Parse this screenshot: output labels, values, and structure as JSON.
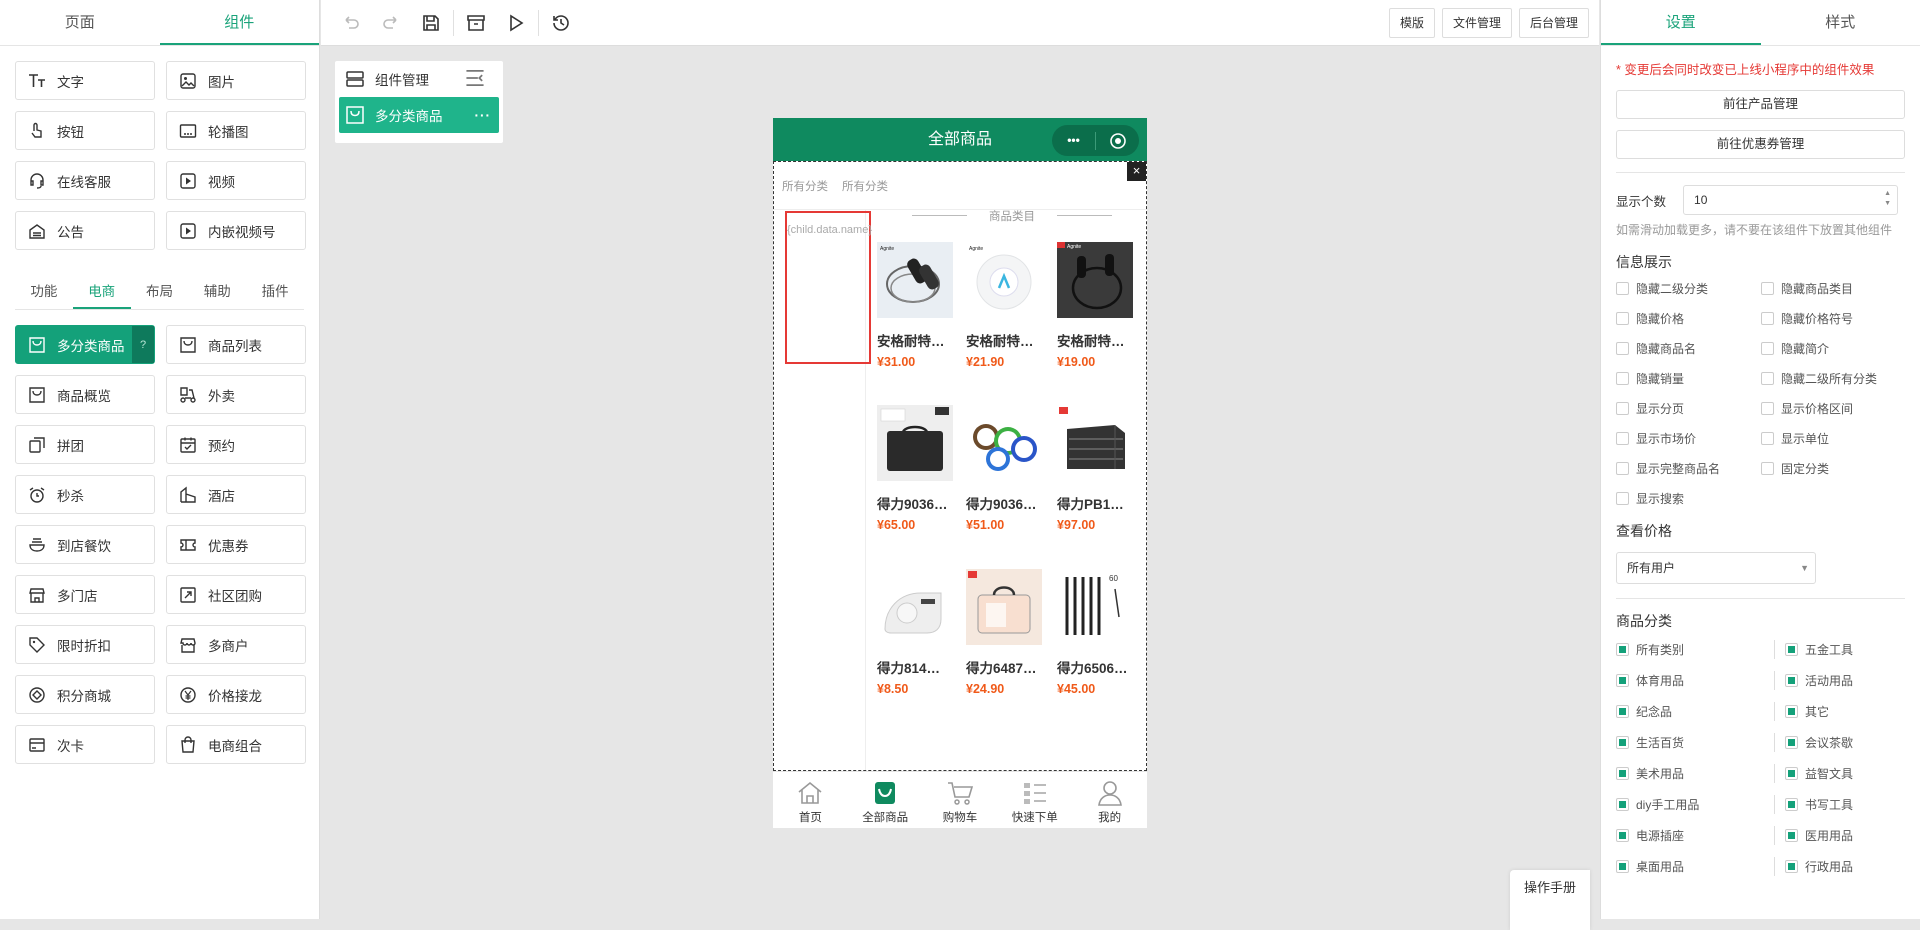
{
  "left": {
    "tabs": [
      "页面",
      "组件"
    ],
    "basic": [
      "文字",
      "图片",
      "按钮",
      "轮播图",
      "在线客服",
      "视频",
      "公告",
      "内嵌视频号"
    ],
    "subtabs": [
      "功能",
      "电商",
      "布局",
      "辅助",
      "插件"
    ],
    "ecommerce": [
      "多分类商品",
      "商品列表",
      "商品概览",
      "外卖",
      "拼团",
      "预约",
      "秒杀",
      "酒店",
      "到店餐饮",
      "优惠券",
      "多门店",
      "社区团购",
      "限时折扣",
      "多商户",
      "积分商城",
      "价格接龙",
      "次卡",
      "电商组合"
    ],
    "help": "?"
  },
  "toolbar": {
    "buttons": [
      "模版",
      "文件管理",
      "后台管理"
    ]
  },
  "component_manager": {
    "title": "组件管理",
    "item": "多分类商品",
    "dots": "···"
  },
  "phone": {
    "title": "全部商品",
    "cap_dots": "•••",
    "close": "×",
    "cats": [
      "所有分类",
      "所有分类"
    ],
    "placeholder": "{child.data.name}",
    "section_title": "商品类目",
    "products": [
      {
        "name": "安格耐特…",
        "price": "¥31.00"
      },
      {
        "name": "安格耐特…",
        "price": "¥21.90"
      },
      {
        "name": "安格耐特…",
        "price": "¥19.00"
      },
      {
        "name": "得力9036…",
        "price": "¥65.00"
      },
      {
        "name": "得力9036…",
        "price": "¥51.00"
      },
      {
        "name": "得力PB1…",
        "price": "¥97.00"
      },
      {
        "name": "得力814…",
        "price": "¥8.50"
      },
      {
        "name": "得力6487…",
        "price": "¥24.90"
      },
      {
        "name": "得力6506…",
        "price": "¥45.00"
      }
    ],
    "tabbar": [
      "首页",
      "全部商品",
      "购物车",
      "快速下单",
      "我的"
    ],
    "accent": "#0f8a5f"
  },
  "right": {
    "tabs": [
      "设置",
      "样式"
    ],
    "warning": "* 变更后会同时改变已上线小程序中的组件效果",
    "btn_product": "前往产品管理",
    "btn_coupon": "前往优惠券管理",
    "count_label": "显示个数",
    "count_value": "10",
    "hint": "如需滑动加载更多，请不要在该组件下放置其他组件",
    "info_title": "信息展示",
    "info_options": [
      "隐藏二级分类",
      "隐藏商品类目",
      "隐藏价格",
      "隐藏价格符号",
      "隐藏商品名",
      "隐藏简介",
      "隐藏销量",
      "隐藏二级所有分类",
      "显示分页",
      "显示价格区间",
      "显示市场价",
      "显示单位",
      "显示完整商品名",
      "固定分类",
      "显示搜索"
    ],
    "price_title": "查看价格",
    "price_value": "所有用户",
    "group_title": "商品分类",
    "groups": [
      "所有类别",
      "五金工具",
      "体育用品",
      "活动用品",
      "纪念品",
      "其它",
      "生活百货",
      "会议茶歇",
      "美术用品",
      "益智文具",
      "diy手工用品",
      "书写工具",
      "电源插座",
      "医用用品",
      "桌面用品",
      "行政用品"
    ]
  },
  "float": {
    "manual": "操作手册"
  }
}
